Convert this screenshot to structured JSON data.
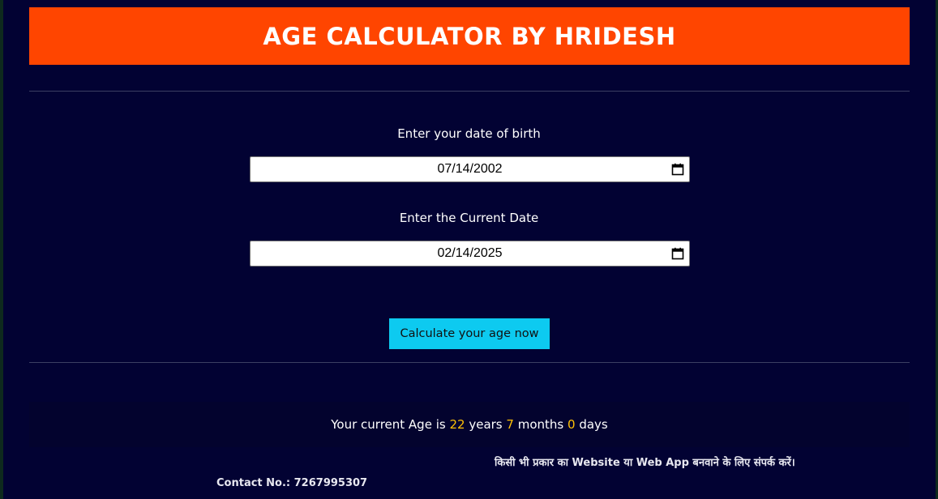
{
  "header": {
    "title": "AGE CALCULATOR BY HRIDESH"
  },
  "form": {
    "dob_label": "Enter your date of birth",
    "dob_value": "07/14/2002",
    "current_label": "Enter the Current Date",
    "current_value": "02/14/2025",
    "calculate_button_label": "Calculate your age now",
    "calendar_icon": "calendar-icon"
  },
  "result": {
    "prefix": "Your current Age is",
    "years": "22",
    "years_label": "years",
    "months": "7",
    "months_label": "months",
    "days": "0",
    "days_label": "days"
  },
  "footer": {
    "note": "किसी भी प्रकार का Website या Web App बनवाने के लिए संपर्क करें।",
    "contact": "Contact No.: 7267995307"
  },
  "colors": {
    "background": "#020233",
    "header": "#ff4500",
    "button": "#0dcaf0",
    "highlight": "#ffc107"
  }
}
